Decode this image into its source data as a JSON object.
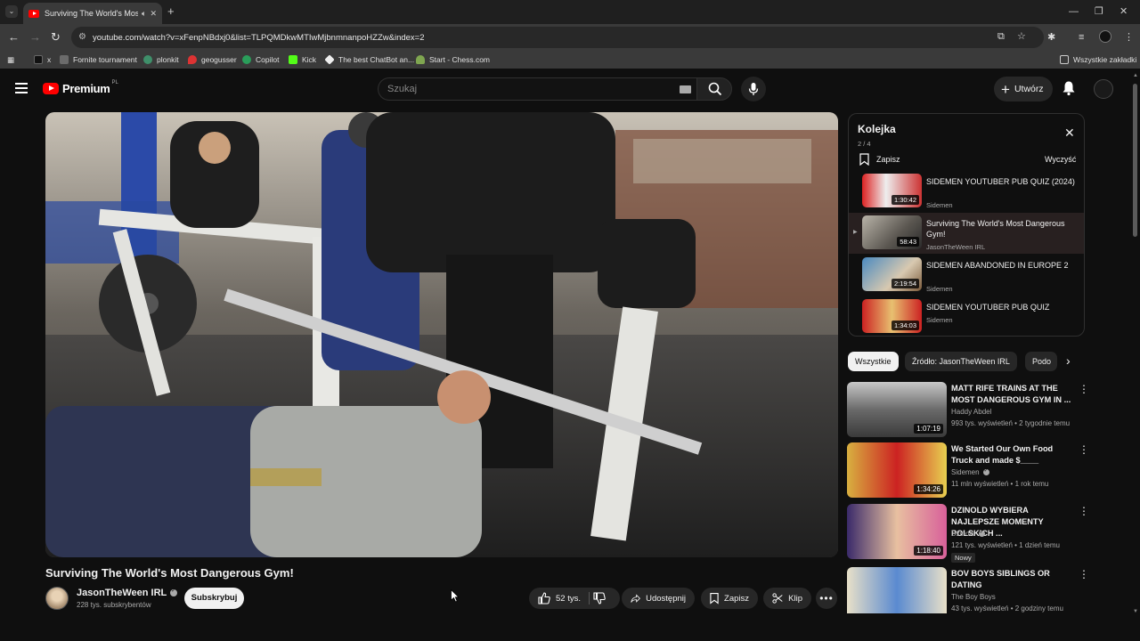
{
  "browser": {
    "tab_title": "Surviving The World's Most",
    "url": "youtube.com/watch?v=xFenpNBdxj0&list=TLPQMDkwMTIwMjbnmnanpoHZZw&index=2",
    "bookmarks": [
      {
        "label": "x",
        "icon": "x-logo-icon",
        "color": "#000000"
      },
      {
        "label": "Fornite tournament",
        "icon": "bookmark-icon",
        "color": "#6b6b6b"
      },
      {
        "label": "plonkit",
        "icon": "globe-icon",
        "color": "#3f8f6a"
      },
      {
        "label": "geogusser",
        "icon": "map-pin-icon",
        "color": "#d33"
      },
      {
        "label": "Copilot",
        "icon": "copilot-icon",
        "color": "#2a9d5a"
      },
      {
        "label": "Kick",
        "icon": "kick-icon",
        "color": "#53fc18"
      },
      {
        "label": "The best ChatBot an...",
        "icon": "chatbot-icon",
        "color": "#eeeeee"
      },
      {
        "label": "Start - Chess.com",
        "icon": "chess-icon",
        "color": "#7fa650"
      }
    ],
    "all_bookmarks_label": "Wszystkie zakładki"
  },
  "header": {
    "logo_text": "Premium",
    "logo_country": "PL",
    "search_placeholder": "Szukaj",
    "create_label": "Utwórz"
  },
  "video": {
    "title": "Surviving The World's Most Dangerous Gym!",
    "channel": "JasonTheWeen IRL",
    "subscribers": "228 tys. subskrybentów",
    "subscribe_label": "Subskrybuj",
    "likes": "52 tys.",
    "share_label": "Udostępnij",
    "save_label": "Zapisz",
    "clip_label": "Klip"
  },
  "queue": {
    "title": "Kolejka",
    "count": "2 / 4",
    "save_label": "Zapisz",
    "clear_label": "Wyczyść",
    "items": [
      {
        "title": "SIDEMEN YOUTUBER PUB QUIZ (2024)",
        "channel": "Sidemen",
        "duration": "1:30:42",
        "active": false
      },
      {
        "title": "Surviving The World's Most Dangerous Gym!",
        "channel": "JasonTheWeen IRL",
        "duration": "58:43",
        "active": true
      },
      {
        "title": "SIDEMEN ABANDONED IN EUROPE 2",
        "channel": "Sidemen",
        "duration": "2:19:54",
        "active": false
      },
      {
        "title": "SIDEMEN YOUTUBER PUB QUIZ",
        "channel": "Sidemen",
        "duration": "1:34:03",
        "active": false
      }
    ]
  },
  "chips": [
    "Wszystkie",
    "Źródło: JasonTheWeen IRL",
    "Podo"
  ],
  "recommendations": [
    {
      "title": "MATT RIFE TRAINS AT THE MOST DANGEROUS GYM IN ...",
      "channel": "Haddy Abdel",
      "meta": "993 tys. wyświetleń • 2 tygodnie temu",
      "duration": "1:07:19",
      "verified": false,
      "badge": ""
    },
    {
      "title": "We Started Our Own Food Truck and made $____",
      "channel": "Sidemen",
      "meta": "11 mln wyświetleń • 1 rok temu",
      "duration": "1:34:26",
      "verified": true,
      "badge": ""
    },
    {
      "title": "DZINOLD WYBIERA NAJLEPSZE MOMENTY POLSKICH ...",
      "channel": "Dzinold",
      "meta": "121 tys. wyświetleń • 1 dzień temu",
      "duration": "1:18:40",
      "verified": true,
      "badge": "Nowy"
    },
    {
      "title": "BOV BOYS SIBLINGS OR DATING",
      "channel": "The Boy Boys",
      "meta": "43 tys. wyświetleń • 2 godziny temu",
      "duration": "",
      "verified": false,
      "badge": ""
    }
  ],
  "colors": {
    "accent": "#ff0000",
    "background": "#0f0f0f",
    "surface": "#272727"
  }
}
